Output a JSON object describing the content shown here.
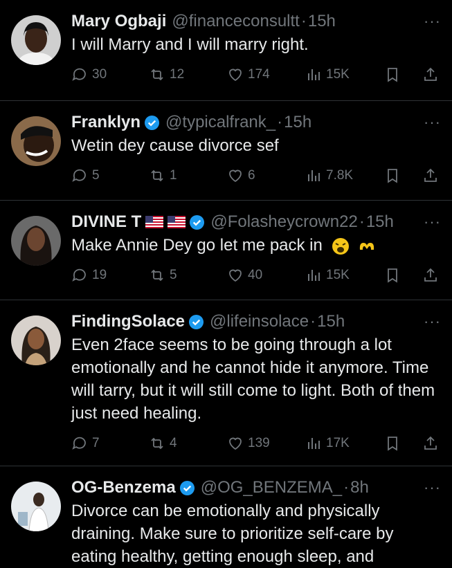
{
  "tweets": [
    {
      "name": "Mary Ogbaji",
      "verified": false,
      "handle": "@financeconsultt",
      "time": "15h",
      "text": "I will Marry and I will marry right.",
      "replies": "30",
      "reposts": "12",
      "likes": "174",
      "views": "15K"
    },
    {
      "name": "Franklyn",
      "verified": true,
      "handle": "@typicalfrank_",
      "time": "15h",
      "text": "Wetin dey cause divorce sef",
      "replies": "5",
      "reposts": "1",
      "likes": "6",
      "views": "7.8K"
    },
    {
      "name": "DIVINE T",
      "verified": true,
      "handle": "@Folasheycrown22",
      "time": "15h",
      "text": "Make Annie Dey go let me pack in",
      "replies": "19",
      "reposts": "5",
      "likes": "40",
      "views": "15K"
    },
    {
      "name": "FindingSolace",
      "verified": true,
      "handle": "@lifeinsolace",
      "time": "15h",
      "text": "Even 2face seems to be going through a lot emotionally and he cannot hide it anymore. Time will tarry, but it will still come to light. Both of them just need healing.",
      "replies": "7",
      "reposts": "4",
      "likes": "139",
      "views": "17K"
    },
    {
      "name": "OG-Benzema",
      "verified": true,
      "handle": "@OG_BENZEMA_",
      "time": "8h",
      "text": "Divorce can be emotionally and physically draining. Make sure to prioritize self-care by eating healthy, getting enough sleep, and"
    }
  ],
  "separator": "·",
  "more_label": "···",
  "colors": {
    "background": "#000000",
    "text": "#e7e9ea",
    "muted": "#71767b",
    "verified": "#1d9bf0",
    "divider": "#2f3336"
  }
}
